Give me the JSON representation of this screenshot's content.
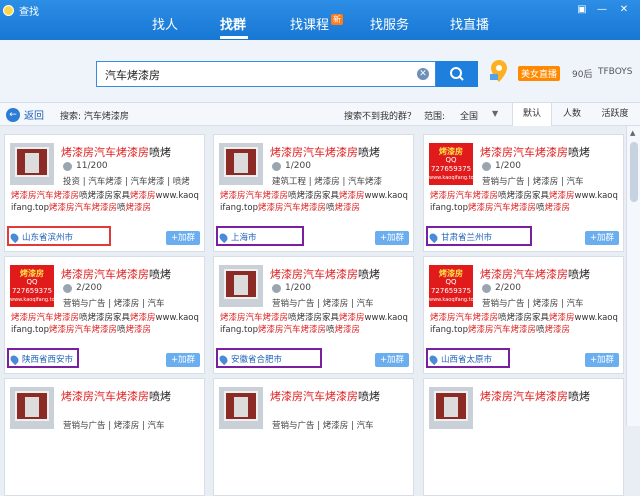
{
  "window": {
    "title": "查找"
  },
  "nav": {
    "tabs": [
      {
        "label": "找人"
      },
      {
        "label": "找群"
      },
      {
        "label": "找课程",
        "badge": "新"
      },
      {
        "label": "找服务"
      },
      {
        "label": "找直播"
      }
    ]
  },
  "search": {
    "query": "汽车烤漆房"
  },
  "user": {
    "badge": "美女直播",
    "age": "90后",
    "name": "TFBOYS"
  },
  "filter": {
    "back_label": "返回",
    "search_label": "搜索: 汽车烤漆房",
    "not_found": "搜索不到我的群？",
    "scope_label": "范围:",
    "scope_value": "全国",
    "sort_tabs": [
      "默认",
      "人数",
      "活跃度"
    ]
  },
  "cards": [
    {
      "title_hl": "烤漆房汽车烤漆房",
      "title_rest": "喷烤",
      "members": "11/200",
      "tags": "投资 | 汽车烤漆 | 汽车烤漆 | 喷烤",
      "desc_hl": "烤漆房汽车烤漆房",
      "desc_rest": "喷烤漆房家具",
      "desc_hl2": "烤漆房",
      "desc_rest2": "www.kaoqifang.top",
      "desc_hl3": "烤漆房汽车烤漆房",
      "desc_rest3": "喷",
      "desc_hl4": "烤漆房",
      "location": "山东省滨州市",
      "join": "+加群",
      "thumb": "photo"
    },
    {
      "title_hl": "烤漆房汽车烤漆房",
      "title_rest": "喷烤",
      "members": "1/200",
      "tags": "建筑工程 | 烤漆房 | 汽车烤漆",
      "desc_hl": "烤漆房汽车烤漆房",
      "desc_rest": "喷烤漆房家具",
      "desc_hl2": "烤漆房",
      "desc_rest2": "www.kaoqifang.top",
      "desc_hl3": "烤漆房汽车烤漆房",
      "desc_rest3": "喷",
      "desc_hl4": "烤漆房",
      "location": "上海市",
      "join": "+加群",
      "thumb": "photo"
    },
    {
      "title_hl": "烤漆房汽车烤漆房",
      "title_rest": "喷烤",
      "members": "1/200",
      "tags": "营销与广告 | 烤漆房 | 汽车",
      "desc_hl": "烤漆房汽车烤漆房",
      "desc_rest": "喷烤漆房家具",
      "desc_hl2": "烤漆房",
      "desc_rest2": "www.kaoqifang.top",
      "desc_hl3": "烤漆房汽车烤漆房",
      "desc_rest3": "喷",
      "desc_hl4": "烤漆房",
      "location": "甘肃省兰州市",
      "join": "+加群",
      "thumb": "red"
    },
    {
      "title_hl": "烤漆房汽车烤漆房",
      "title_rest": "喷烤",
      "members": "2/200",
      "tags": "营销与广告 | 烤漆房 | 汽车",
      "desc_hl": "烤漆房汽车烤漆房",
      "desc_rest": "喷烤漆房家具",
      "desc_hl2": "烤漆房",
      "desc_rest2": "www.kaoqifang.top",
      "desc_hl3": "烤漆房汽车烤漆房",
      "desc_rest3": "喷",
      "desc_hl4": "烤漆房",
      "location": "陕西省西安市",
      "join": "+加群",
      "thumb": "red"
    },
    {
      "title_hl": "烤漆房汽车烤漆房",
      "title_rest": "喷烤",
      "members": "1/200",
      "tags": "营销与广告 | 烤漆房 | 汽车",
      "desc_hl": "烤漆房汽车烤漆房",
      "desc_rest": "喷烤漆房家具",
      "desc_hl2": "烤漆房",
      "desc_rest2": "www.kaoqifang.top",
      "desc_hl3": "烤漆房汽车烤漆房",
      "desc_rest3": "喷",
      "desc_hl4": "烤漆房",
      "location": "安徽省合肥市",
      "join": "+加群",
      "thumb": "photo"
    },
    {
      "title_hl": "烤漆房汽车烤漆房",
      "title_rest": "喷烤",
      "members": "2/200",
      "tags": "营销与广告 | 烤漆房 | 汽车",
      "desc_hl": "烤漆房汽车烤漆房",
      "desc_rest": "喷烤漆房家具",
      "desc_hl2": "烤漆房",
      "desc_rest2": "www.kaoqifang.top",
      "desc_hl3": "烤漆房汽车烤漆房",
      "desc_rest3": "喷",
      "desc_hl4": "烤漆房",
      "location": "山西省太原市",
      "join": "+加群",
      "thumb": "red"
    },
    {
      "title_hl": "烤漆房汽车烤漆房",
      "title_rest": "喷烤",
      "members": "",
      "tags": "营销与广告 | 烤漆房 | 汽车",
      "desc_hl": "",
      "desc_rest": "",
      "desc_hl2": "",
      "desc_rest2": "",
      "desc_hl3": "",
      "desc_rest3": "",
      "desc_hl4": "",
      "location": "",
      "join": "",
      "thumb": "photo"
    },
    {
      "title_hl": "烤漆房汽车烤漆房",
      "title_rest": "喷烤",
      "members": "",
      "tags": "营销与广告 | 烤漆房 | 汽车",
      "desc_hl": "",
      "desc_rest": "",
      "desc_hl2": "",
      "desc_rest2": "",
      "desc_hl3": "",
      "desc_rest3": "",
      "desc_hl4": "",
      "location": "",
      "join": "",
      "thumb": "photo"
    },
    {
      "title_hl": "烤漆房汽车烤漆房",
      "title_rest": "喷烤",
      "members": "",
      "tags": "",
      "desc_hl": "",
      "desc_rest": "",
      "desc_hl2": "",
      "desc_rest2": "",
      "desc_hl3": "",
      "desc_rest3": "",
      "desc_hl4": "",
      "location": "",
      "join": "",
      "thumb": "photo"
    }
  ],
  "thumb_text": {
    "line1": "烤漆房",
    "line2": "QQ",
    "line3": "727659375",
    "line4": "www.kaoqifang.top"
  }
}
